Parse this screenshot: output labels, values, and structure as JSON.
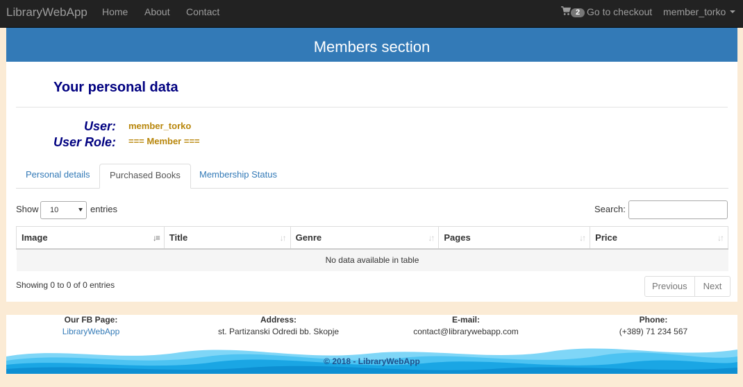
{
  "navbar": {
    "brand": "LibraryWebApp",
    "links": {
      "home": "Home",
      "about": "About",
      "contact": "Contact"
    },
    "cart_count": "2",
    "checkout": "Go to checkout",
    "user": "member_torko"
  },
  "section": {
    "title": "Members section"
  },
  "profile": {
    "title": "Your personal data",
    "user_label": "User:",
    "user_value": "member_torko",
    "role_label": "User Role:",
    "role_value": "=== Member ==="
  },
  "tabs": {
    "personal": "Personal details",
    "purchased": "Purchased Books",
    "membership": "Membership Status",
    "active": "Purchased Books"
  },
  "table": {
    "show_label": "Show",
    "page_length": "10",
    "entries_label": "entries",
    "search_label": "Search:",
    "search_value": "",
    "columns": [
      "Image",
      "Title",
      "Genre",
      "Pages",
      "Price"
    ],
    "empty_message": "No data available in table",
    "info": "Showing 0 to 0 of 0 entries",
    "prev": "Previous",
    "next": "Next"
  },
  "footer": {
    "fb_label": "Our FB Page:",
    "fb_value": "LibraryWebApp",
    "address_label": "Address:",
    "address_value": "st. Partizanski Odredi bb. Skopje",
    "email_label": "E-mail:",
    "email_value": "contact@librarywebapp.com",
    "phone_label": "Phone:",
    "phone_value": "(+389) 71 234 567",
    "copyright": "© 2018 - LibraryWebApp"
  },
  "colors": {
    "navbar": "#222222",
    "header": "#337ab7",
    "accent_navy": "#000080",
    "accent_gold": "#b8860b",
    "page_bg": "#fbebd5"
  }
}
